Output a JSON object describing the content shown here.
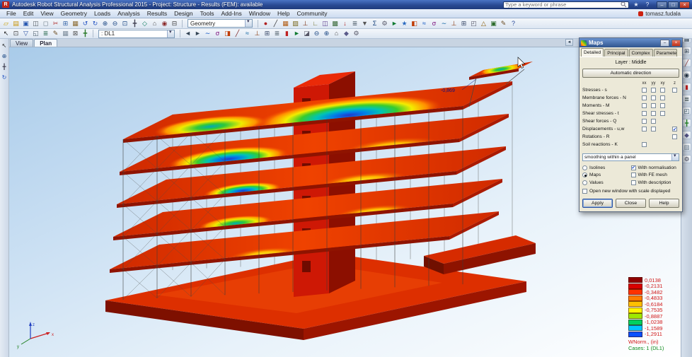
{
  "window": {
    "title": "Autodesk Robot Structural Analysis Professional 2015 - Project: Structure - Results (FEM): available",
    "search_placeholder": "Type a keyword or phrase",
    "user": "tomasz.fudala",
    "controls": {
      "minimize": "–",
      "maximize": "□",
      "close": "×"
    }
  },
  "menu": {
    "items": [
      "File",
      "Edit",
      "View",
      "Geometry",
      "Loads",
      "Analysis",
      "Results",
      "Design",
      "Tools",
      "Add-Ins",
      "Window",
      "Help",
      "Community"
    ]
  },
  "toolbars": {
    "geometry_combo": "Geometry",
    "case_combo": ": DL1",
    "row1_left": [
      {
        "name": "new-project",
        "glyph": "▱",
        "color": "#caa008"
      },
      {
        "name": "open-project",
        "glyph": "▤",
        "color": "#c8940a"
      },
      {
        "name": "save-project",
        "glyph": "▣",
        "color": "#2858b0"
      },
      {
        "name": "print",
        "glyph": "◫",
        "color": "#50595f"
      },
      {
        "name": "print-preview",
        "glyph": "◻",
        "color": "#6a7a85"
      },
      {
        "name": "cut",
        "glyph": "✂",
        "color": "#b03030"
      },
      {
        "name": "copy",
        "glyph": "⊞",
        "color": "#3565a8"
      },
      {
        "name": "paste",
        "glyph": "▦",
        "color": "#8a6a30"
      },
      {
        "name": "undo",
        "glyph": "↺",
        "color": "#2353c2"
      },
      {
        "name": "redo",
        "glyph": "↻",
        "color": "#2353c2"
      },
      {
        "name": "zoom-in",
        "glyph": "⊕",
        "color": "#1f4a86"
      },
      {
        "name": "zoom-out",
        "glyph": "⊖",
        "color": "#1f4a86"
      },
      {
        "name": "zoom-window",
        "glyph": "⊡",
        "color": "#1f4a86"
      },
      {
        "name": "pan-view",
        "glyph": "╋",
        "color": "#445"
      },
      {
        "name": "view-3d",
        "glyph": "◇",
        "color": "#0a7a5a"
      },
      {
        "name": "initial-view",
        "glyph": "⌂",
        "color": "#555"
      },
      {
        "name": "screen-capture",
        "glyph": "◉",
        "color": "#8a2a2a"
      },
      {
        "name": "calculator",
        "glyph": "⊟",
        "color": "#444"
      }
    ],
    "row1_right": [
      {
        "name": "nodes",
        "glyph": "●",
        "color": "#b02020"
      },
      {
        "name": "bars",
        "glyph": "╱",
        "color": "#333"
      },
      {
        "name": "panels",
        "glyph": "▦",
        "color": "#b05a10"
      },
      {
        "name": "claddings",
        "glyph": "▨",
        "color": "#7a6a20"
      },
      {
        "name": "supports",
        "glyph": "⊥",
        "color": "#7d3010"
      },
      {
        "name": "releases",
        "glyph": "∟",
        "color": "#6a6a20"
      },
      {
        "name": "sections",
        "glyph": "◫",
        "color": "#5a3a8a"
      },
      {
        "name": "materials",
        "glyph": "▩",
        "color": "#3a6a3a"
      },
      {
        "name": "loads",
        "glyph": "↓",
        "color": "#b02020"
      },
      {
        "name": "load-table",
        "glyph": "≣",
        "color": "#4a5a66"
      },
      {
        "name": "self-weight",
        "glyph": "▼",
        "color": "#555"
      },
      {
        "name": "combinations",
        "glyph": "Σ",
        "color": "#16407a"
      },
      {
        "name": "analysis-types",
        "glyph": "⚙",
        "color": "#556"
      },
      {
        "name": "calculate",
        "glyph": "►",
        "color": "#0e7a30"
      },
      {
        "name": "results-status",
        "glyph": "★",
        "color": "#2a6ac0"
      },
      {
        "name": "maps",
        "glyph": "◧",
        "color": "#c03a00"
      },
      {
        "name": "diagrams",
        "glyph": "≈",
        "color": "#0a50c0"
      },
      {
        "name": "stress-map",
        "glyph": "σ",
        "color": "#7a0a7a"
      },
      {
        "name": "deformation",
        "glyph": "∼",
        "color": "#0a60a0"
      },
      {
        "name": "reactions",
        "glyph": "⊥",
        "color": "#8a3a10"
      },
      {
        "name": "tables",
        "glyph": "⊞",
        "color": "#3a4a6a"
      },
      {
        "name": "screen-layout",
        "glyph": "◰",
        "color": "#556"
      },
      {
        "name": "steel-design",
        "glyph": "△",
        "color": "#8a5a00"
      },
      {
        "name": "rc-design",
        "glyph": "▣",
        "color": "#2a6a2a"
      },
      {
        "name": "notes",
        "glyph": "✎",
        "color": "#6a4a20"
      },
      {
        "name": "help-topics",
        "glyph": "?",
        "color": "#2a4a9a"
      }
    ],
    "row2_left": [
      {
        "name": "selection-arrow",
        "glyph": "↖",
        "color": "#222"
      },
      {
        "name": "select-all",
        "glyph": "⊡",
        "color": "#444"
      },
      {
        "name": "display-filters",
        "glyph": "▽",
        "color": "#2a50a0"
      },
      {
        "name": "view-manager",
        "glyph": "◱",
        "color": "#50616e"
      },
      {
        "name": "object-inspector",
        "glyph": "≣",
        "color": "#2a6a50"
      },
      {
        "name": "edit-mode",
        "glyph": "✎",
        "color": "#6a4a20"
      },
      {
        "name": "grid-step",
        "glyph": "▦",
        "color": "#7a8a99"
      },
      {
        "name": "snap-settings",
        "glyph": "⊠",
        "color": "#555"
      },
      {
        "name": "coordinate-system",
        "glyph": "╋",
        "color": "#2a7a2a"
      }
    ],
    "row2_right": [
      {
        "name": "case-prev",
        "glyph": "◄",
        "color": "#345"
      },
      {
        "name": "case-next",
        "glyph": "►",
        "color": "#345"
      },
      {
        "name": "bar-forces",
        "glyph": "∼",
        "color": "#0a50c0"
      },
      {
        "name": "bar-stresses",
        "glyph": "σ",
        "color": "#7a0a7a"
      },
      {
        "name": "panel-maps",
        "glyph": "◨",
        "color": "#c03a00"
      },
      {
        "name": "panel-cuts",
        "glyph": "╱",
        "color": "#7a2020"
      },
      {
        "name": "deformed-shape",
        "glyph": "≈",
        "color": "#0a60a0"
      },
      {
        "name": "reactions-view",
        "glyph": "⊥",
        "color": "#8a3a10"
      },
      {
        "name": "displacement-values",
        "glyph": "⊞",
        "color": "#3a4a6a"
      },
      {
        "name": "results-tables",
        "glyph": "≣",
        "color": "#4a5a66"
      },
      {
        "name": "map-legend",
        "glyph": "▮",
        "color": "#c02020"
      },
      {
        "name": "animate-results",
        "glyph": "►",
        "color": "#0e7a30"
      },
      {
        "name": "layers",
        "glyph": "◪",
        "color": "#556"
      },
      {
        "name": "zoom-previous",
        "glyph": "⊖",
        "color": "#1f4a86"
      },
      {
        "name": "zoom-next",
        "glyph": "⊕",
        "color": "#1f4a86"
      },
      {
        "name": "full-view",
        "glyph": "⌂",
        "color": "#555"
      },
      {
        "name": "render-mode",
        "glyph": "◆",
        "color": "#5a5a8a"
      },
      {
        "name": "display-options",
        "glyph": "⚙",
        "color": "#556"
      }
    ],
    "left_strip": [
      {
        "name": "select-cursor",
        "glyph": "↖",
        "color": "#222"
      },
      {
        "name": "zoom-dynamic",
        "glyph": "⊕",
        "color": "#1f4a86"
      },
      {
        "name": "pan-hand",
        "glyph": "╋",
        "color": "#445"
      },
      {
        "name": "rotate-view",
        "glyph": "↻",
        "color": "#2353c2"
      }
    ],
    "right_strip": [
      {
        "name": "view-settings",
        "glyph": "◧",
        "color": "#445"
      },
      {
        "name": "display-attributes",
        "glyph": "▦",
        "color": "#456"
      },
      {
        "name": "numbering",
        "glyph": "⊞",
        "color": "#345"
      },
      {
        "name": "section-pane",
        "glyph": "╱",
        "color": "#822"
      },
      {
        "name": "camera-view",
        "glyph": "◉",
        "color": "#234"
      },
      {
        "name": "selected-tool",
        "glyph": "▮",
        "color": "#c02020"
      },
      {
        "name": "tables-pane",
        "glyph": "≣",
        "color": "#455"
      },
      {
        "name": "plan-pane",
        "glyph": "◰",
        "color": "#356"
      },
      {
        "name": "axes-toggle",
        "glyph": "╋",
        "color": "#282"
      },
      {
        "name": "render-pane",
        "glyph": "◆",
        "color": "#558"
      },
      {
        "name": "grid-toggle",
        "glyph": "▨",
        "color": "#789"
      },
      {
        "name": "app-options",
        "glyph": "⚙",
        "color": "#445"
      }
    ]
  },
  "view_tabs": {
    "items": [
      "View",
      "Plan"
    ],
    "active": "Plan",
    "scroll_left": "◄"
  },
  "maps_dialog": {
    "title": "Maps",
    "tabs": [
      "Detailed",
      "Principal",
      "Complex",
      "Parameters"
    ],
    "active_tab": "Detailed",
    "layer_label": "Layer : Middle",
    "auto_direction_button": "Automatic direction",
    "col_headers": [
      "xx",
      "yy",
      "xy",
      "z"
    ],
    "rows": [
      {
        "label": "Stresses - s",
        "cols": [
          1,
          1,
          1
        ],
        "z": 1,
        "zchecked": 0
      },
      {
        "label": "Membrane forces - N",
        "cols": [
          1,
          1,
          1
        ],
        "z": 0,
        "zchecked": 0
      },
      {
        "label": "Moments - M",
        "cols": [
          1,
          1,
          1
        ],
        "z": 0,
        "zchecked": 0
      },
      {
        "label": "Shear stresses - t",
        "cols": [
          1,
          1,
          1
        ],
        "z": 0,
        "zchecked": 0
      },
      {
        "label": "Shear forces - Q",
        "cols": [
          1,
          1,
          0
        ],
        "z": 0,
        "zchecked": 0
      },
      {
        "label": "Displacements - u,w",
        "cols": [
          1,
          1,
          0
        ],
        "z": 1,
        "zchecked": 1
      },
      {
        "label": "Rotations - R",
        "cols": [
          0,
          0,
          0
        ],
        "z": 1,
        "zchecked": 0
      },
      {
        "label": "Soil reactions - K",
        "cols": [
          1,
          0,
          0
        ],
        "z": 0,
        "zchecked": 0
      }
    ],
    "smoothing_combo": "smoothing within a panel",
    "radios": [
      {
        "label": "Isolines",
        "selected": false
      },
      {
        "label": "Maps",
        "selected": true
      },
      {
        "label": "Values",
        "selected": false
      }
    ],
    "right_checks": [
      {
        "label": "With normalisation",
        "checked": true
      },
      {
        "label": "With FE mesh",
        "checked": false
      },
      {
        "label": "With description",
        "checked": false
      }
    ],
    "open_new_window": {
      "label": "Open new window with scale displayed",
      "checked": false
    },
    "buttons": [
      "Apply",
      "Close",
      "Help"
    ]
  },
  "legend": {
    "entries": [
      {
        "value": "0,0138",
        "color": "#8f0000"
      },
      {
        "value": "-0,2131",
        "color": "#d90000"
      },
      {
        "value": "-0,3482",
        "color": "#ff3300"
      },
      {
        "value": "-0,4833",
        "color": "#ff7d00"
      },
      {
        "value": "-0,6184",
        "color": "#ffc000"
      },
      {
        "value": "-0,7535",
        "color": "#fff500"
      },
      {
        "value": "-0,8887",
        "color": "#9fe800"
      },
      {
        "value": "-1,0238",
        "color": "#00d060"
      },
      {
        "value": "-1,1589",
        "color": "#00c6ff"
      },
      {
        "value": "-1,2911",
        "color": "#0a50ff"
      }
    ],
    "unit_label": "WNorm., (in)",
    "cases_label": "Cases: 1 (DL1)"
  },
  "viewport": {
    "annotation": "-0,869",
    "axes": {
      "x": "x",
      "y": "y",
      "z": "z"
    }
  }
}
